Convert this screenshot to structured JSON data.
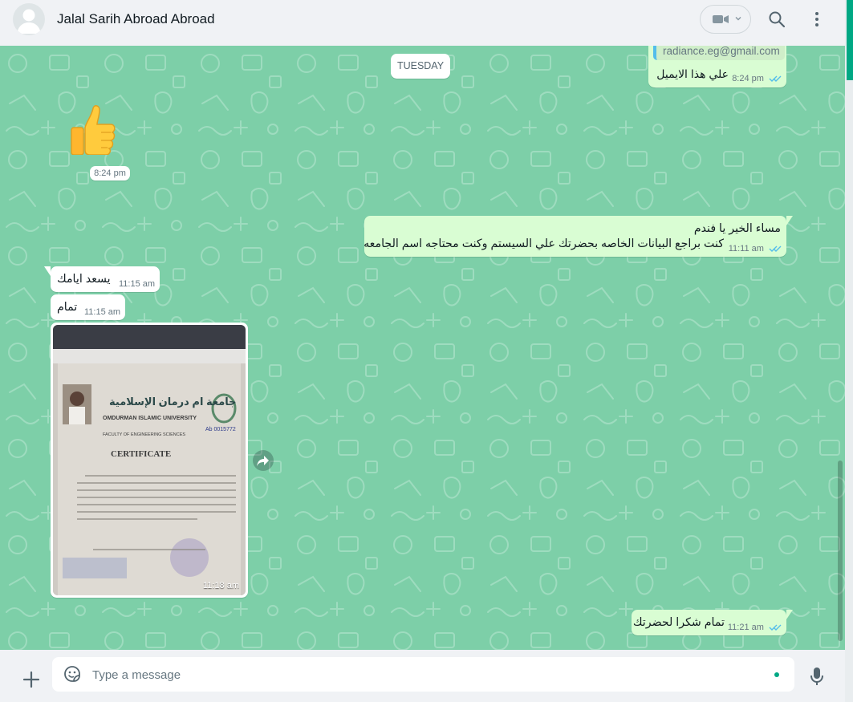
{
  "header": {
    "contact_name": "Jalal Sarih Abroad Abroad",
    "icons": [
      "avatar",
      "video-call-icon",
      "chevron-down-icon",
      "search-icon",
      "menu-icon"
    ]
  },
  "chat": {
    "day_separator": "TUESDAY",
    "messages": [
      {
        "direction": "outgoing",
        "partial_text": "radiance.eg@gmail.com",
        "text": "علي هذا الايميل",
        "time": "8:24 pm",
        "status": "read"
      },
      {
        "direction": "incoming",
        "type": "emoji",
        "emoji": "👍",
        "time": "8:24 pm"
      },
      {
        "direction": "outgoing",
        "lines": [
          "مساء الخير يا فندم",
          "كنت براجع البيانات الخاصه بحضرتك علي السيستم وكنت محتاجه اسم الجامعه"
        ],
        "time": "11:11 am",
        "status": "read"
      },
      {
        "direction": "incoming",
        "text": "يسعد ايامك",
        "time": "11:15 am"
      },
      {
        "direction": "incoming",
        "text": "تمام",
        "time": "11:15 am"
      },
      {
        "direction": "incoming",
        "type": "image",
        "time": "11:18 am",
        "image": {
          "university_ar": "جامعة ام درمان الإسلامية",
          "university_en": "OMDURMAN ISLAMIC UNIVERSITY",
          "faculty": "FACULTY OF ENGINEERING SCIENCES",
          "heading": "CERTIFICATE",
          "number": "Ab 0015772"
        }
      },
      {
        "direction": "outgoing",
        "text": "تمام شكرا لحضرتك",
        "time": "11:21 am",
        "status": "read"
      }
    ]
  },
  "composer": {
    "placeholder": "Type a message",
    "icons": [
      "plus-icon",
      "sticker-icon",
      "mic-icon"
    ]
  },
  "colors": {
    "chat_background": "#7dcfa8",
    "outgoing_bubble": "#d9fdd3",
    "incoming_bubble": "#ffffff",
    "read_ticks": "#53bdeb",
    "accent": "#00a884"
  }
}
